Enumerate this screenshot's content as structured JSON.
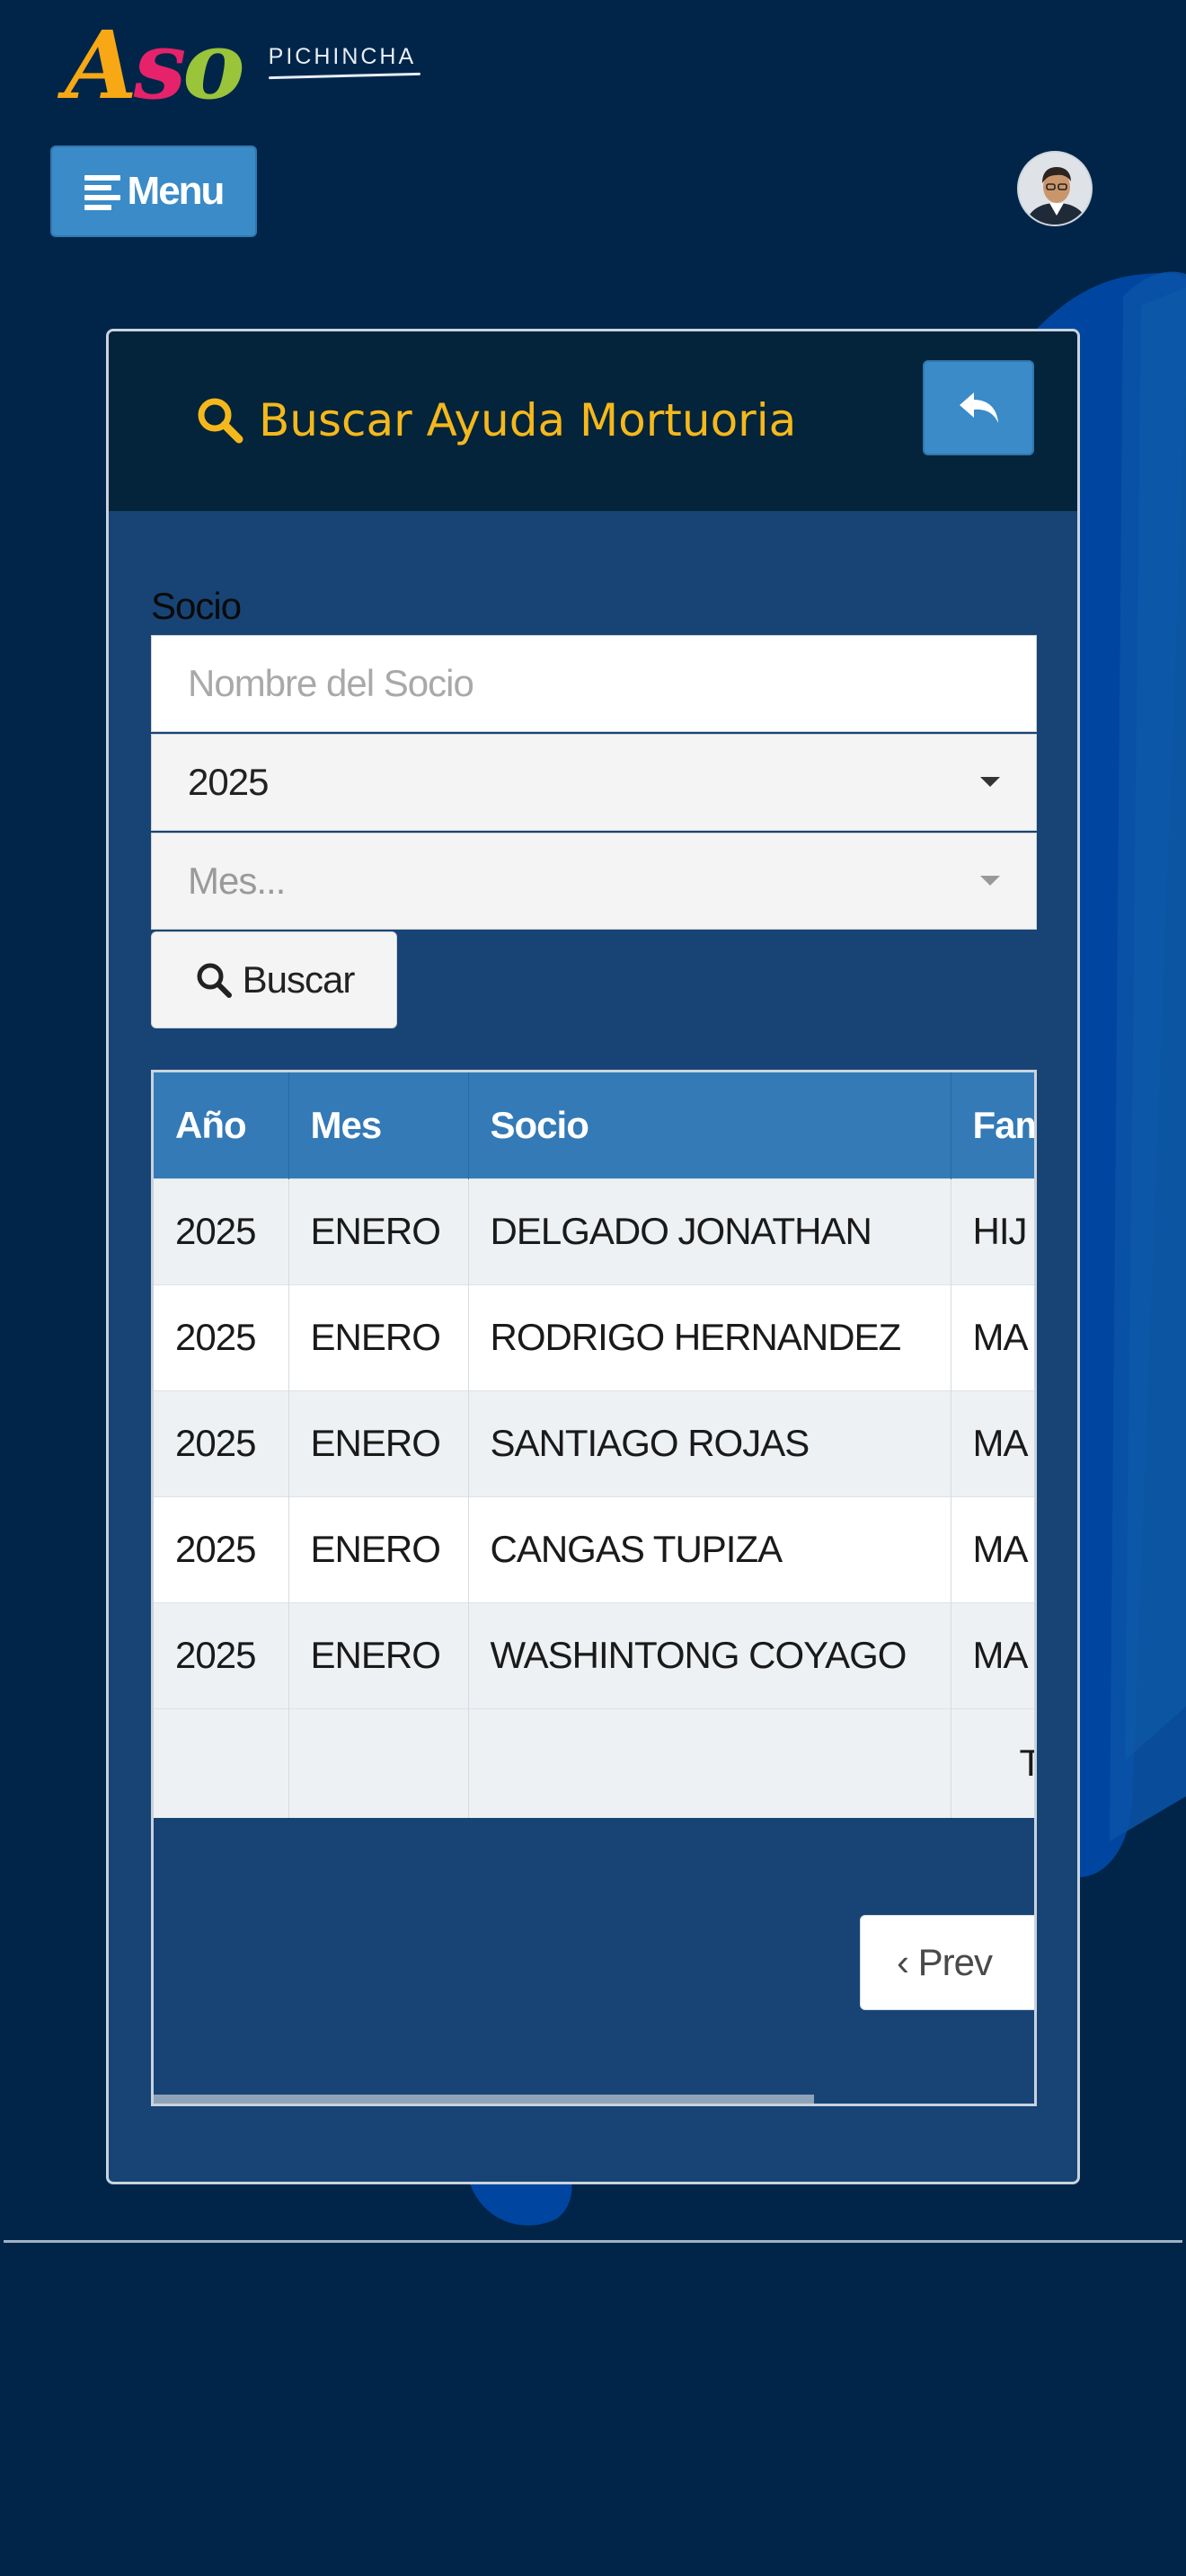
{
  "brand": {
    "logo_letters": [
      "A",
      "s",
      "o"
    ],
    "logo_subtitle": "PICHINCHA",
    "colors": {
      "a": "#f7a814",
      "s": "#e6226b",
      "o": "#9ac43a"
    }
  },
  "header": {
    "menu_label": "Menu",
    "avatar_icon": "user-avatar"
  },
  "page": {
    "title": "Buscar Ayuda Mortuoria",
    "title_icon": "search-icon",
    "back_icon": "reply-arrow-icon"
  },
  "form": {
    "socio_label": "Socio",
    "name_placeholder": "Nombre del Socio",
    "name_value": "",
    "year_value": "2025",
    "month_placeholder": "Mes...",
    "search_label": "Buscar"
  },
  "table": {
    "headers": [
      "Año",
      "Mes",
      "Socio",
      "Fam"
    ],
    "rows": [
      [
        "2025",
        "ENERO",
        "DELGADO JONATHAN",
        "HIJ"
      ],
      [
        "2025",
        "ENERO",
        "RODRIGO HERNANDEZ",
        "MA"
      ],
      [
        "2025",
        "ENERO",
        "SANTIAGO ROJAS",
        "MA"
      ],
      [
        "2025",
        "ENERO",
        "CANGAS TUPIZA",
        "MA"
      ],
      [
        "2025",
        "ENERO",
        "WASHINTONG COYAGO",
        "MA"
      ]
    ],
    "total_row_fragment": "T"
  },
  "pagination": {
    "prev_label": "‹ Prev"
  },
  "colors": {
    "background": "#012549",
    "card": "#174475",
    "card_header": "#03243a",
    "accent": "#3a8bc8",
    "title": "#f5b81c",
    "table_header": "#337ab7"
  }
}
